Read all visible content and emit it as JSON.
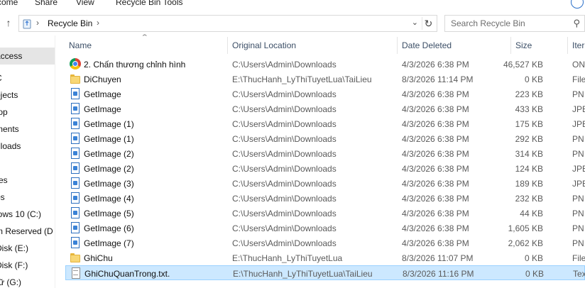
{
  "ribbon": {
    "tabs": [
      "come",
      "Share",
      "View",
      "Recycle Bin Tools"
    ]
  },
  "address": {
    "breadcrumb": "Recycle Bin",
    "search_placeholder": "Search Recycle Bin"
  },
  "nav": {
    "items": [
      {
        "label": "access",
        "selected": true
      },
      {
        "label": "C",
        "selected": false
      },
      {
        "label": "bjects",
        "selected": false
      },
      {
        "label": "top",
        "selected": false
      },
      {
        "label": "ments",
        "selected": false
      },
      {
        "label": "nloads",
        "selected": false
      },
      {
        "label": "c",
        "selected": false
      },
      {
        "label": "res",
        "selected": false
      },
      {
        "label": "os",
        "selected": false
      },
      {
        "label": "lows 10 (C:)",
        "selected": false
      },
      {
        "label": "m Reserved (D",
        "selected": false
      },
      {
        "label": "Disk (E:)",
        "selected": false
      },
      {
        "label": "Disk (F:)",
        "selected": false
      },
      {
        "label": "rữ (G:)",
        "selected": false
      }
    ]
  },
  "columns": {
    "name": "Name",
    "original_location": "Original Location",
    "date_deleted": "Date Deleted",
    "size": "Size",
    "item_type": "Iter"
  },
  "files": [
    {
      "name": "2. Chấn thương chỉnh hình",
      "icon": "chrome-icon",
      "location": "C:\\Users\\Admin\\Downloads",
      "date": "4/3/2026 6:38 PM",
      "size": "46,527 KB",
      "type": "ON",
      "selected": false
    },
    {
      "name": "DiChuyen",
      "icon": "folder-icon",
      "location": "E:\\ThucHanh_LyThiTuyetLua\\TaiLieu",
      "date": "8/3/2026 11:14 PM",
      "size": "0 KB",
      "type": "File",
      "selected": false
    },
    {
      "name": "GetImage",
      "icon": "image-file-icon",
      "location": "C:\\Users\\Admin\\Downloads",
      "date": "4/3/2026 6:38 PM",
      "size": "223 KB",
      "type": "PN",
      "selected": false
    },
    {
      "name": "GetImage",
      "icon": "image-file-icon",
      "location": "C:\\Users\\Admin\\Downloads",
      "date": "4/3/2026 6:38 PM",
      "size": "433 KB",
      "type": "JPE",
      "selected": false
    },
    {
      "name": "GetImage (1)",
      "icon": "image-file-icon",
      "location": "C:\\Users\\Admin\\Downloads",
      "date": "4/3/2026 6:38 PM",
      "size": "175 KB",
      "type": "JPE",
      "selected": false
    },
    {
      "name": "GetImage (1)",
      "icon": "image-file-icon",
      "location": "C:\\Users\\Admin\\Downloads",
      "date": "4/3/2026 6:38 PM",
      "size": "292 KB",
      "type": "PN",
      "selected": false
    },
    {
      "name": "GetImage (2)",
      "icon": "image-file-icon",
      "location": "C:\\Users\\Admin\\Downloads",
      "date": "4/3/2026 6:38 PM",
      "size": "314 KB",
      "type": "PN",
      "selected": false
    },
    {
      "name": "GetImage (2)",
      "icon": "image-file-icon",
      "location": "C:\\Users\\Admin\\Downloads",
      "date": "4/3/2026 6:38 PM",
      "size": "124 KB",
      "type": "JPE",
      "selected": false
    },
    {
      "name": "GetImage (3)",
      "icon": "image-file-icon",
      "location": "C:\\Users\\Admin\\Downloads",
      "date": "4/3/2026 6:38 PM",
      "size": "189 KB",
      "type": "JPE",
      "selected": false
    },
    {
      "name": "GetImage (4)",
      "icon": "image-file-icon",
      "location": "C:\\Users\\Admin\\Downloads",
      "date": "4/3/2026 6:38 PM",
      "size": "232 KB",
      "type": "PN",
      "selected": false
    },
    {
      "name": "GetImage (5)",
      "icon": "image-file-icon",
      "location": "C:\\Users\\Admin\\Downloads",
      "date": "4/3/2026 6:38 PM",
      "size": "44 KB",
      "type": "PN",
      "selected": false
    },
    {
      "name": "GetImage (6)",
      "icon": "image-file-icon",
      "location": "C:\\Users\\Admin\\Downloads",
      "date": "4/3/2026 6:38 PM",
      "size": "1,605 KB",
      "type": "PN",
      "selected": false
    },
    {
      "name": "GetImage (7)",
      "icon": "image-file-icon",
      "location": "C:\\Users\\Admin\\Downloads",
      "date": "4/3/2026 6:38 PM",
      "size": "2,062 KB",
      "type": "PN",
      "selected": false
    },
    {
      "name": "GhiChu",
      "icon": "folder-icon",
      "location": "E:\\ThucHanh_LyThiTuyetLua",
      "date": "8/3/2026 11:07 PM",
      "size": "0 KB",
      "type": "File",
      "selected": false
    },
    {
      "name": "GhiChuQuanTrong.txt.",
      "icon": "text-file-icon",
      "location": "E:\\ThucHanh_LyThiTuyetLua\\TaiLieu",
      "date": "8/3/2026 11:16 PM",
      "size": "0 KB",
      "type": "Tex",
      "selected": true
    }
  ],
  "colors": {
    "selection_bg": "#cce8ff",
    "selection_border": "#99d1ff",
    "header_text": "#3b4e66",
    "nav_selected": "#e5e5e5"
  }
}
